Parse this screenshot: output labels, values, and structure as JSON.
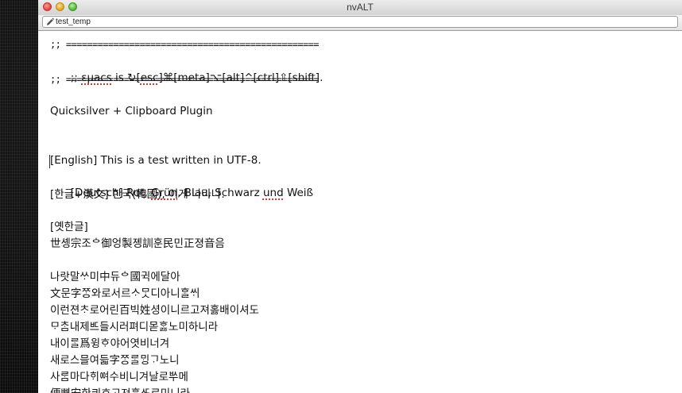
{
  "window": {
    "title": "nvALT"
  },
  "search": {
    "value": "test_temp"
  },
  "note": {
    "line1": ";; ================================================",
    "line2_prefix": ";; ",
    "line2_emacs": "εμacs",
    "line2_mid": " is ↻[",
    "line2_esc": "esc",
    "line2_rest": "]⌘[meta]⌥[alt]^[ctrl]⇧[shift].",
    "line3": ";; ================================================",
    "heading": "Quicksilver + Clipboard Plugin",
    "english": "[English] This is a test written in UTF-8.",
    "deutsch_prefix": "[Deutsch] Rot, ",
    "deutsch_grun": "Grün",
    "deutsch_mid": ", Blau, Schwarz ",
    "deutsch_und": "und",
    "deutsch_rest": " Weiß",
    "korean": "[한글+漢文] 한국(韓國), 이게 나라냐.",
    "old_korean_label": "[옛한글]",
    "old1": "世솅宗조ᅌ御엉製졩訓훈民민正졍音음",
    "old2": "나랏말ᄊᆞ미中듀ᅌ國귁에달아",
    "old3": "文문字ᄍᆞᆼ와로서르ᄉᆞᄆᆞᆺ디아니ᄒᆞᆯᄊᆡ",
    "old4": "이런젼ᄎᆞ로어린百빅姓셩이니르고져호ᇙ배이셔도",
    "old5": "ᄆᆞᄎᆞᆷ내제ᄠᅳ들시러펴디몯ᄒᆞᇙ노미하니라",
    "old6": "내이ᄅᆞᆯ爲윙ᄒᆞ야어엿비너겨",
    "old7": "새로스믈여듧字ᄍᆞᆼᄅᆞᆯᄆᆡᆼᄀᆞ노니",
    "old8": "사ᄅᆞᆷ마다ᄒᆡᅇᅧ수비니겨날로ᄡᅮ메",
    "old9": "便뼌安한킈ᄒᆞ고져ᄒᆞᇙᄯᆞᄅᆞ미니라"
  },
  "colors": {
    "close": "#e0443e",
    "minimize": "#dea123",
    "maximize": "#4fb338",
    "spellcheck": "#d23a3a"
  },
  "icons": {
    "edit": "pencil-icon",
    "pointer": "mouse-pointer-icon"
  }
}
